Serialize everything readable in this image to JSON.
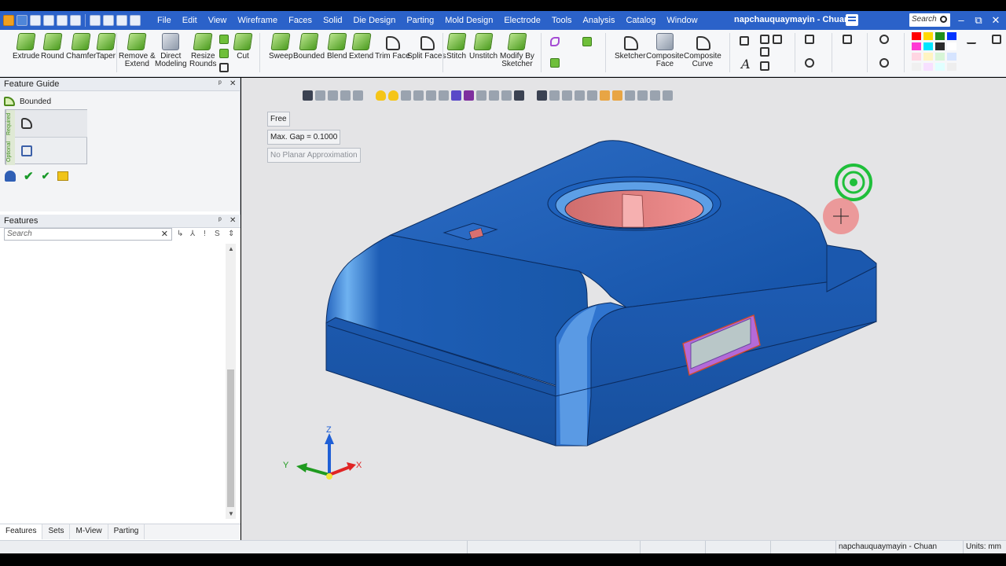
{
  "app": {
    "document_title": "napchauquaymayin - Chuan",
    "search_placeholder": "Search"
  },
  "menu": [
    "File",
    "Edit",
    "View",
    "Wireframe",
    "Faces",
    "Solid",
    "Die Design",
    "Parting",
    "Mold Design",
    "Electrode",
    "Tools",
    "Analysis",
    "Catalog",
    "Window"
  ],
  "ribbon": {
    "extrude": "Extrude",
    "round": "Round",
    "chamfer": "Chamfer",
    "taper": "Taper",
    "remove_extend_1": "Remove &",
    "remove_extend_2": "Extend",
    "direct_modeling_1": "Direct",
    "direct_modeling_2": "Modeling",
    "resize_rounds_1": "Resize",
    "resize_rounds_2": "Rounds",
    "cut": "Cut",
    "sweep": "Sweep",
    "bounded": "Bounded",
    "blend": "Blend",
    "extend": "Extend",
    "trim_face": "Trim Face",
    "split_faces": "Split Faces",
    "stitch": "Stitch",
    "unstitch": "Unstitch",
    "modify_by_sketcher_1": "Modify By",
    "modify_by_sketcher_2": "Sketcher",
    "sketcher": "Sketcher",
    "composite_face_1": "Composite",
    "composite_face_2": "Face",
    "composite_curve_1": "Composite",
    "composite_curve_2": "Curve",
    "text_tool": "A"
  },
  "palette_colors": [
    "#ff0000",
    "#ffd800",
    "#1f8f1f",
    "#0033ff",
    "#ff3ad4",
    "#00e5ff",
    "#2b2b2b",
    "#ffffff",
    "#ffd6e2",
    "#fff4c2",
    "#d7f5d7",
    "#d6e4ff",
    "#f0f0f0",
    "#f7e0ff",
    "#e0ffff",
    "#eeeeee"
  ],
  "feature_guide": {
    "header": "Feature Guide",
    "feature_name": "Bounded",
    "required_label": "Required",
    "optional_label": "Optional",
    "ok_symbol": "✔",
    "apply_symbol": "✔"
  },
  "features_panel": {
    "header": "Features",
    "search_placeholder": "Search",
    "clear_symbol": "✕",
    "tool_symbols": [
      "↳",
      "⅄",
      "!",
      "S",
      "⇕"
    ]
  },
  "bottom_tabs": [
    "Features",
    "Sets",
    "M-View",
    "Parting"
  ],
  "viewport": {
    "options": {
      "mode": "Free",
      "max_gap": "Max. Gap =  0.1000",
      "planar": "No Planar Approximation"
    },
    "axes": {
      "x": "X",
      "y": "Y",
      "z": "Z"
    }
  },
  "status": {
    "document": "napchauquaymayin - Chuan",
    "units": "Units: mm"
  },
  "window_controls": [
    "–",
    "⧉",
    "✕"
  ],
  "panel_controls": [
    "ᵖ",
    "✕"
  ]
}
